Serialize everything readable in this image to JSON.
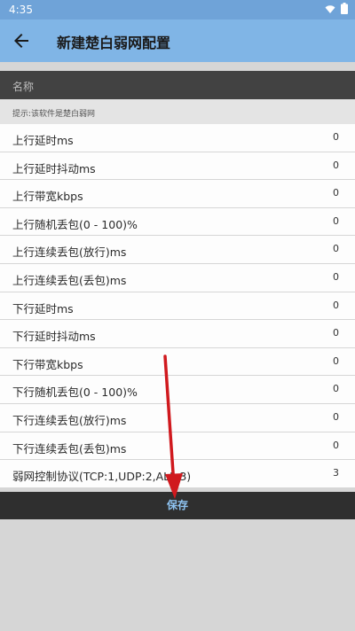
{
  "status_bar": {
    "time": "4:35",
    "icons": [
      "wifi-icon",
      "battery-icon"
    ]
  },
  "app_bar": {
    "title": "新建楚白弱网配置",
    "back_icon": "arrow-left-icon"
  },
  "name_section": {
    "label": "名称"
  },
  "hint": {
    "text": "提示:该软件是楚白弱网"
  },
  "rows": [
    {
      "label": "上行延时ms",
      "value": "0"
    },
    {
      "label": "上行延时抖动ms",
      "value": "0"
    },
    {
      "label": "上行带宽kbps",
      "value": "0"
    },
    {
      "label": "上行随机丢包(0 - 100)%",
      "value": "0"
    },
    {
      "label": "上行连续丢包(放行)ms",
      "value": "0"
    },
    {
      "label": "上行连续丢包(丢包)ms",
      "value": "0"
    },
    {
      "label": "下行延时ms",
      "value": "0"
    },
    {
      "label": "下行延时抖动ms",
      "value": "0"
    },
    {
      "label": "下行带宽kbps",
      "value": "0"
    },
    {
      "label": "下行随机丢包(0 - 100)%",
      "value": "0"
    },
    {
      "label": "下行连续丢包(放行)ms",
      "value": "0"
    },
    {
      "label": "下行连续丢包(丢包)ms",
      "value": "0"
    },
    {
      "label": "弱网控制协议(TCP:1,UDP:2,ALL:3)",
      "value": "3"
    }
  ],
  "save_button": {
    "label": "保存"
  },
  "colors": {
    "app_bar": "#80b5e6",
    "status_bar": "#6fa3d8",
    "name_bar": "#424242",
    "save_bar": "#2f2f2f",
    "save_text": "#8fc4f2",
    "annotation_arrow": "#d0191e"
  }
}
